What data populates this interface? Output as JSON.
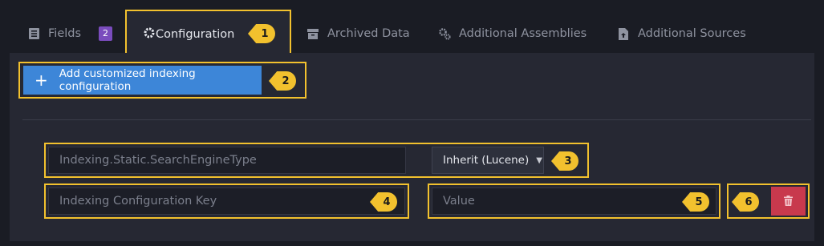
{
  "tabs": [
    {
      "label": "Fields",
      "icon": "list-icon",
      "badge": "2"
    },
    {
      "label": "Configuration",
      "icon": "gear-icon"
    },
    {
      "label": "Archived Data",
      "icon": "archive-icon"
    },
    {
      "label": "Additional Assemblies",
      "icon": "gears-icon"
    },
    {
      "label": "Additional Sources",
      "icon": "file-upload-icon"
    }
  ],
  "toolbar": {
    "add_config_label": "Add customized indexing configuration"
  },
  "config_row": {
    "key_value": "Indexing.Static.SearchEngineType",
    "engine_select": "Inherit (Lucene)"
  },
  "new_row": {
    "key_placeholder": "Indexing Configuration Key",
    "value_placeholder": "Value"
  },
  "callouts": [
    "1",
    "2",
    "3",
    "4",
    "5",
    "6"
  ],
  "colors": {
    "highlight": "#f2c12e",
    "primary": "#3d86d8",
    "danger": "#c8394d",
    "badge": "#7a4cbd",
    "background": "#1a1c24",
    "panel": "#262833"
  }
}
